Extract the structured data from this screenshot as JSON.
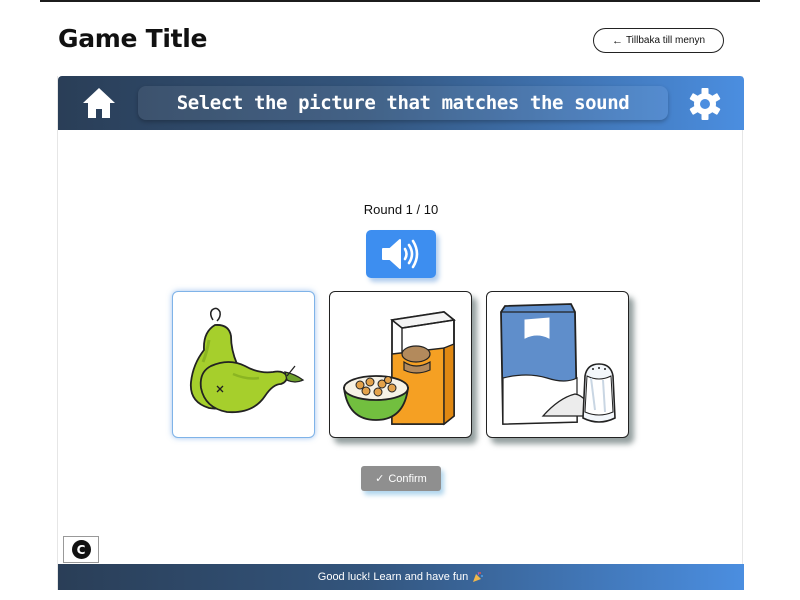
{
  "page": {
    "title": "Game Title",
    "back_label": "Tillbaka till menyn",
    "back_icon": "arrow-left-icon"
  },
  "game": {
    "instruction": "Select the picture that matches the sound",
    "round_label": "Round 1 / 10",
    "icons": {
      "home": "home-icon",
      "settings": "gear-icon",
      "sound": "speaker-icon",
      "credit": "copyright-icon"
    },
    "choices": [
      {
        "name": "pears",
        "selected": true
      },
      {
        "name": "cereal-bowl",
        "selected": false
      },
      {
        "name": "flour-and-salt",
        "selected": false
      }
    ],
    "confirm_label": "Confirm",
    "credit_label": "C",
    "footer_text": "Good luck! Learn and have fun",
    "footer_icon": "party-popper-icon",
    "colors": {
      "header_dark": "#2a3e57",
      "header_light": "#4b8ee0",
      "sound_button": "#3d8ef0",
      "confirm_button": "#8f8f8f"
    }
  }
}
